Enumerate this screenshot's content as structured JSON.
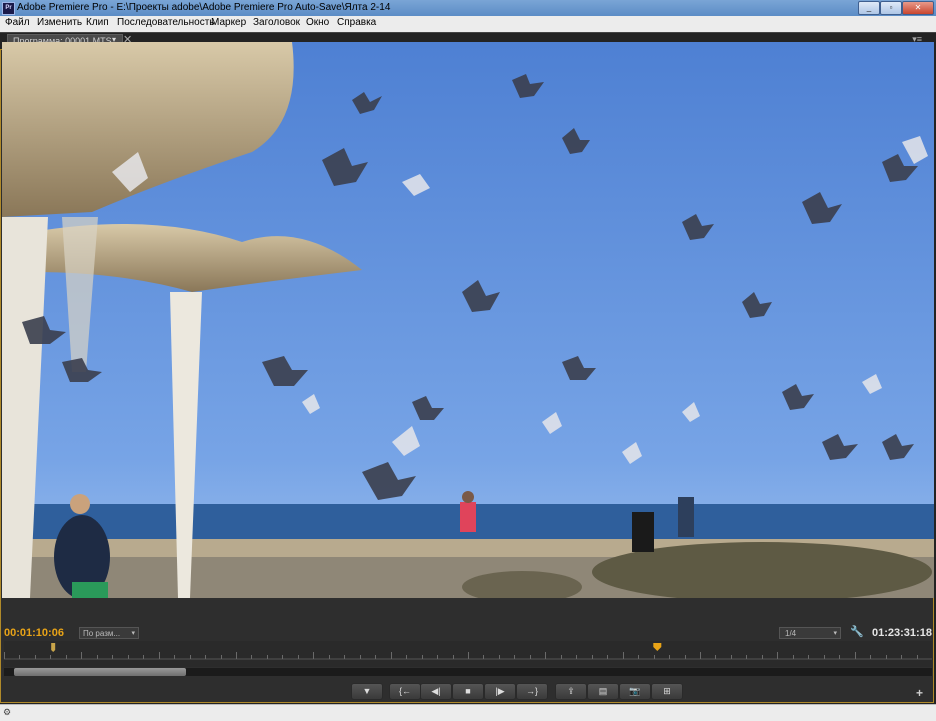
{
  "window": {
    "title": "Adobe Premiere Pro - E:\\Проекты adobe\\Adobe Premiere Pro Auto-Save\\Ялта 2-14",
    "icon": "Pr",
    "minimize": "_",
    "maximize": "▫",
    "close": "✕"
  },
  "menu": [
    "Файл",
    "Изменить",
    "Клип",
    "Последовательность",
    "Маркер",
    "Заголовок",
    "Окно",
    "Справка"
  ],
  "panel": {
    "tab_label": "Программа: 00001.MTS",
    "tab_menu": "▾",
    "tab_close": "✕",
    "panel_menu": "▾≡"
  },
  "monitor": {
    "current_timecode": "00:01:10:06",
    "fit_select": "По разм...",
    "resolution_select": "1/4",
    "duration_timecode": "01:23:31:18",
    "playhead_fraction": 0.704,
    "in_marker_fraction": 0.053,
    "zoom_bar_thumb_fraction": [
      0.011,
      0.196
    ]
  },
  "colors": {
    "timecode_active": "#e8a317",
    "panel_border_active": "#b08a2a",
    "panel_background": "#232323"
  },
  "controls": [
    {
      "name": "add-marker-button",
      "icon": "marker-icon",
      "glyph": "▼"
    },
    {
      "name": "go-to-in-button",
      "icon": "go-to-in-icon",
      "glyph": "{←"
    },
    {
      "name": "step-back-button",
      "icon": "step-back-icon",
      "glyph": "◀|"
    },
    {
      "name": "stop-button",
      "icon": "stop-icon",
      "glyph": "■"
    },
    {
      "name": "step-forward-button",
      "icon": "step-forward-icon",
      "glyph": "|▶"
    },
    {
      "name": "go-to-out-button",
      "icon": "go-to-out-icon",
      "glyph": "→}"
    },
    {
      "name": "lift-button",
      "icon": "lift-icon",
      "glyph": "⇪"
    },
    {
      "name": "extract-button",
      "icon": "extract-icon",
      "glyph": "▤"
    },
    {
      "name": "export-frame-button",
      "icon": "camera-icon",
      "glyph": "📷"
    },
    {
      "name": "compare-view-button",
      "icon": "compare-icon",
      "glyph": "⊞"
    }
  ],
  "add_button": "+",
  "status_icon": "⚙"
}
